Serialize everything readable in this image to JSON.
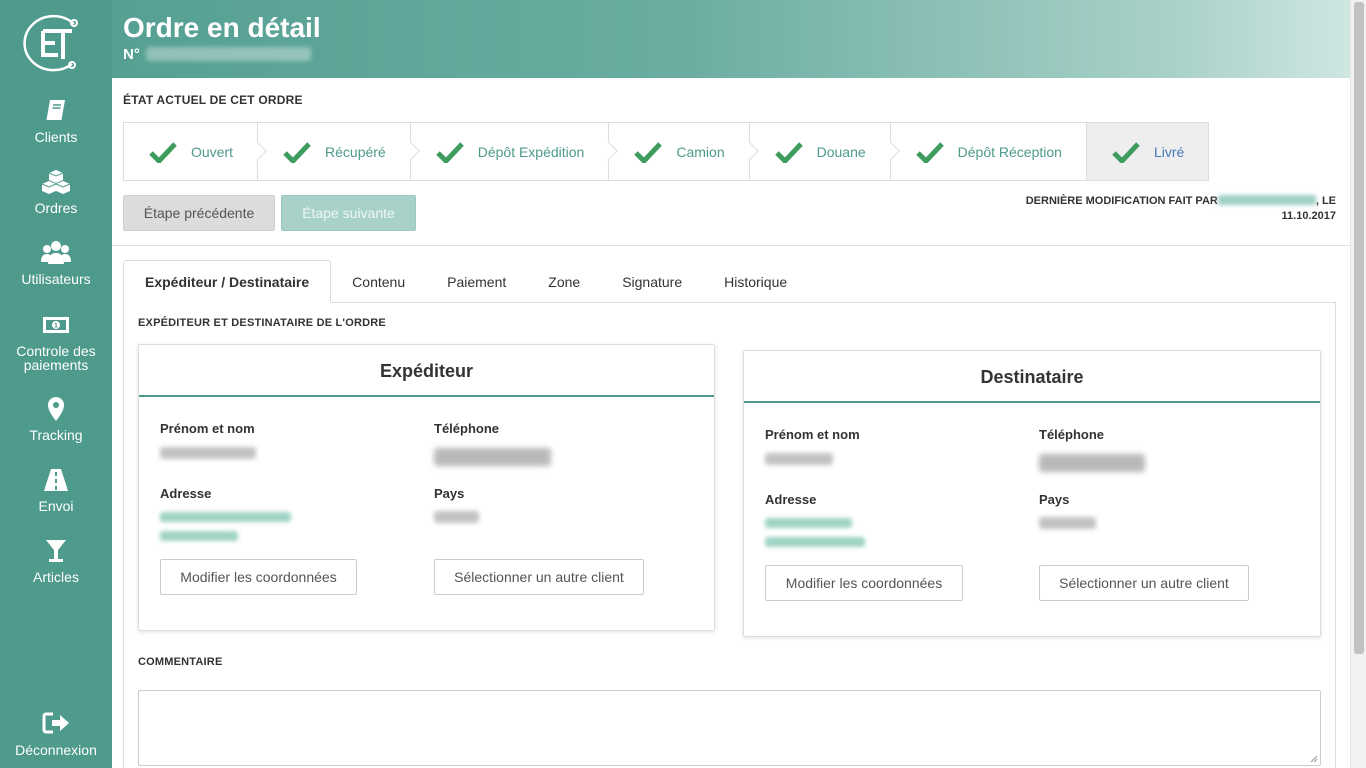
{
  "sidebar": {
    "logo_text": "ET",
    "items": [
      {
        "label": "Clients",
        "icon": "book-icon"
      },
      {
        "label": "Ordres",
        "icon": "boxes-icon"
      },
      {
        "label": "Utilisateurs",
        "icon": "users-icon"
      },
      {
        "label": "Controle des paiements",
        "icon": "money-icon"
      },
      {
        "label": "Tracking",
        "icon": "map-pin-icon"
      },
      {
        "label": "Envoi",
        "icon": "road-icon"
      },
      {
        "label": "Articles",
        "icon": "glass-icon"
      }
    ],
    "logout_label": "Déconnexion"
  },
  "header": {
    "title": "Ordre en détail",
    "number_prefix": "N°"
  },
  "status": {
    "section_title": "ÉTAT ACTUEL DE CET ORDRE",
    "steps": [
      {
        "label": "Ouvert"
      },
      {
        "label": "Récupéré"
      },
      {
        "label": "Dépôt Expédition"
      },
      {
        "label": "Camion"
      },
      {
        "label": "Douane"
      },
      {
        "label": "Dépôt Réception"
      },
      {
        "label": "Livré"
      }
    ],
    "current_step": "Livré",
    "prev_button": "Étape précédente",
    "next_button": "Étape suivante",
    "last_modified_prefix": "DERNIÈRE MODIFICATION FAIT PAR",
    "last_modified_suffix": ", LE",
    "last_modified_date": "11.10.2017"
  },
  "tabs": [
    {
      "label": "Expéditeur / Destinataire",
      "active": true
    },
    {
      "label": "Contenu"
    },
    {
      "label": "Paiement"
    },
    {
      "label": "Zone"
    },
    {
      "label": "Signature"
    },
    {
      "label": "Historique"
    }
  ],
  "panel": {
    "section_title": "EXPÉDITEUR ET DESTINATAIRE DE L'ORDRE",
    "sender": {
      "title": "Expéditeur",
      "name_label": "Prénom et nom",
      "phone_label": "Téléphone",
      "address_label": "Adresse",
      "country_label": "Pays",
      "edit_button": "Modifier les coordonnées",
      "select_button": "Sélectionner un autre client"
    },
    "recipient": {
      "title": "Destinataire",
      "name_label": "Prénom et nom",
      "phone_label": "Téléphone",
      "address_label": "Adresse",
      "country_label": "Pays",
      "edit_button": "Modifier les coordonnées",
      "select_button": "Sélectionner un autre client"
    },
    "comment_title": "COMMENTAIRE"
  },
  "colors": {
    "brand": "#4e9a8c",
    "current_step": "#4a78b8"
  }
}
